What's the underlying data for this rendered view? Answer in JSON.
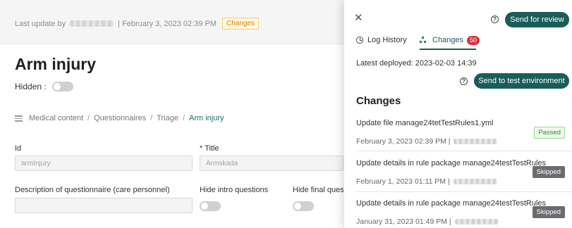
{
  "header": {
    "last_update_prefix": "Last update by",
    "last_update_suffix": "| February 3, 2023 02:39 PM",
    "changes_badge": "Changes"
  },
  "page": {
    "title": "Arm injury",
    "hidden_label": "Hidden :"
  },
  "breadcrumb": {
    "items": [
      "Medical content",
      "Questionnaires",
      "Triage",
      "Arm injury"
    ]
  },
  "form": {
    "id_label": "Id",
    "id_value": "armInjury",
    "title_label": "* Title",
    "title_value": "Armskada",
    "description_label": "Description of questionnaire (care personnel)",
    "hide_intro_label": "Hide intro questions",
    "hide_final_label": "Hide final questi"
  },
  "drawer": {
    "close_icon": "close-icon",
    "help_glyph": "?",
    "send_review_label": "Send for review",
    "tabs": [
      {
        "label": "Log History",
        "icon": "clock-icon"
      },
      {
        "label": "Changes",
        "icon": "hierarchy-icon",
        "count": "50"
      }
    ],
    "latest_deployed": "Latest deployed: 2023-02-03 14:39",
    "send_test_label": "Send to test environment",
    "changes_heading": "Changes",
    "changes": [
      {
        "title": "Update file manage24tetTestRules1.yml",
        "date": "February 3, 2023 02:39 PM |",
        "status": "Passed"
      },
      {
        "title": "Update details in rule package manage24testTestRules",
        "date": "February 1, 2023 01:11 PM |",
        "status": "Skipped"
      },
      {
        "title": "Update details in rule package manage24testTestRules",
        "date": "January 31, 2023 01:49 PM |",
        "status": "Skipped"
      }
    ]
  },
  "colors": {
    "primary": "#1a5d58",
    "badge_red": "#d8323a",
    "passed_green": "#2f8f3a",
    "skipped_gray": "#6c6c70",
    "changes_badge_orange": "#c98a12"
  }
}
